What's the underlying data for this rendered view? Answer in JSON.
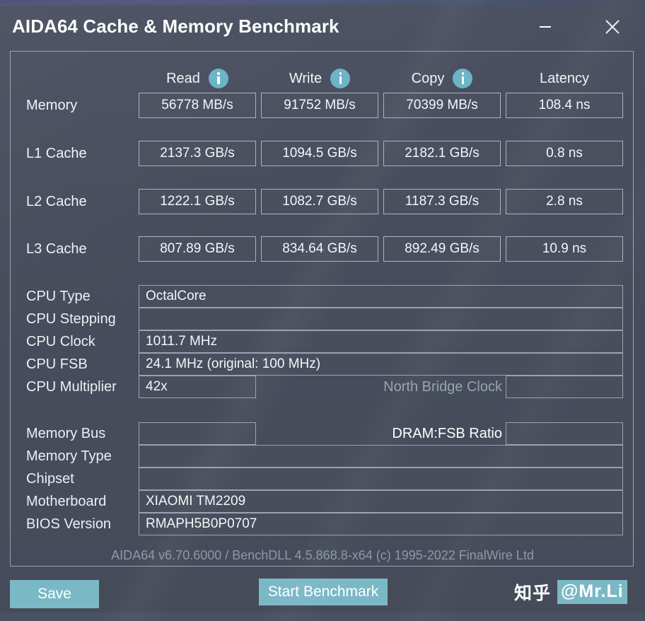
{
  "window": {
    "title": "AIDA64 Cache & Memory Benchmark",
    "minimize_label": "minimize",
    "close_label": "close",
    "accent_color": "#7bb8c6",
    "info_icon_color": "#6cb4c6",
    "background_color": "#474d5c"
  },
  "benchmark": {
    "columns": [
      {
        "label": "Read",
        "has_info": true
      },
      {
        "label": "Write",
        "has_info": true
      },
      {
        "label": "Copy",
        "has_info": true
      },
      {
        "label": "Latency",
        "has_info": false
      }
    ],
    "rows": [
      {
        "label": "Memory",
        "read": "56778 MB/s",
        "write": "91752 MB/s",
        "copy": "70399 MB/s",
        "latency": "108.4 ns"
      },
      {
        "label": "L1 Cache",
        "read": "2137.3 GB/s",
        "write": "1094.5 GB/s",
        "copy": "2182.1 GB/s",
        "latency": "0.8 ns"
      },
      {
        "label": "L2 Cache",
        "read": "1222.1 GB/s",
        "write": "1082.7 GB/s",
        "copy": "1187.3 GB/s",
        "latency": "2.8 ns"
      },
      {
        "label": "L3 Cache",
        "read": "807.89 GB/s",
        "write": "834.64 GB/s",
        "copy": "892.49 GB/s",
        "latency": "10.9 ns"
      }
    ]
  },
  "cpu_info": {
    "rows": [
      {
        "label": "CPU Type",
        "value": "OctalCore"
      },
      {
        "label": "CPU Stepping",
        "value": ""
      },
      {
        "label": "CPU Clock",
        "value": "1011.7 MHz"
      },
      {
        "label": "CPU FSB",
        "value": "24.1 MHz  (original: 100 MHz)"
      },
      {
        "label": "CPU Multiplier",
        "value": "42x"
      }
    ],
    "north_bridge_clock_label": "North Bridge Clock",
    "north_bridge_clock_value": ""
  },
  "memory_info": {
    "rows": [
      {
        "label": "Memory Bus",
        "value": ""
      },
      {
        "label": "Memory Type",
        "value": ""
      },
      {
        "label": "Chipset",
        "value": ""
      },
      {
        "label": "Motherboard",
        "value": "XIAOMI TM2209"
      },
      {
        "label": "BIOS Version",
        "value": "RMAPH5B0P0707"
      }
    ],
    "dram_fsb_ratio_label": "DRAM:FSB Ratio",
    "dram_fsb_ratio_value": ""
  },
  "footer": {
    "version_text": "AIDA64 v6.70.6000 / BenchDLL 4.5.868.8-x64  (c) 1995-2022 FinalWire Ltd",
    "save_label": "Save",
    "start_label": "Start Benchmark"
  },
  "watermark": {
    "site": "知乎",
    "handle": "@Mr.Li"
  }
}
